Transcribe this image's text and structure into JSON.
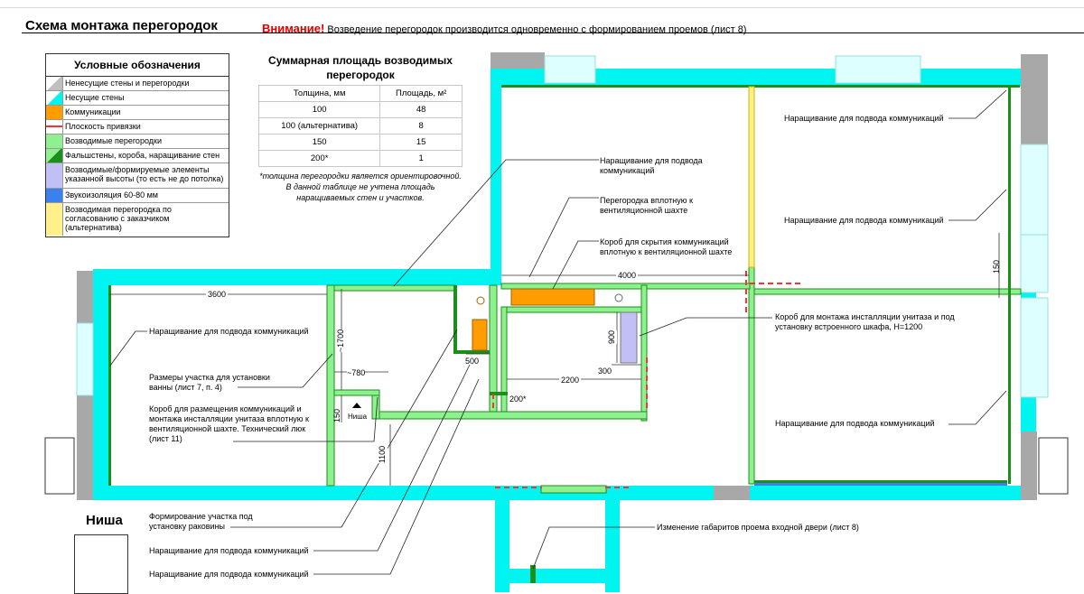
{
  "title": "Схема монтажа перегородок",
  "warning": {
    "bold": "Внимание!",
    "text": "Возведение перегородок производится одновременно с формированием проемов (лист 8)"
  },
  "legend": {
    "title": "Условные обозначения",
    "items": [
      {
        "label": "Ненесущие стены и перегородки",
        "color": "#bfbfbf"
      },
      {
        "label": "Несущие стены",
        "color": "#00f5f0"
      },
      {
        "label": "Коммуникации",
        "color": "#ff9c00"
      },
      {
        "label": "Плоскость привязки",
        "color": "#ff3030"
      },
      {
        "label": "Возводимые перегородки",
        "color": "#8ef08e"
      },
      {
        "label": "Фальшстены, короба, наращивание стен",
        "color": "#1a8f1a"
      },
      {
        "label": "Возводимые/формируемые элементы указанной высоты (то есть не до потолка)",
        "color": "#c0c0f4"
      },
      {
        "label": "Звукоизоляция 60-80 мм",
        "color": "#3a80ee"
      },
      {
        "label": "Возводимая перегородка по согласованию с заказчиком (альтернатива)",
        "color": "#fff08a"
      }
    ]
  },
  "summary": {
    "title": "Суммарная площадь возводимых перегородок",
    "headers": [
      "Толщина, мм",
      "Площадь, м²"
    ],
    "rows": [
      [
        "100",
        "48"
      ],
      [
        "100 (альтернатива)",
        "8"
      ],
      [
        "150",
        "15"
      ],
      [
        "200*",
        "1"
      ]
    ],
    "note": "*толщина перегородки является ориентировочной. В данной таблице не учтена площадь наращиваемых стен и участков."
  },
  "annotations": {
    "a1": "Наращивание для подвода коммуникаций",
    "a2": "Перегородка вплотную к вентиляционной шахте",
    "a3": "Короб для скрытия коммуникаций вплотную к вентиляционной шахте",
    "a4": "Наращивание для подвода коммуникаций",
    "a5": "Наращивание для подвода коммуникаций",
    "a6": "Короб для монтажа инсталляции унитаза и под установку встроенного шкафа, H=1200",
    "a7": "Наращивание для подвода коммуникаций",
    "a8": "Наращивание для подвода коммуникаций",
    "a9": "Размеры участка для установки ванны (лист 7, п. 4)",
    "a10": "Короб для размещения коммуникаций и монтажа инсталляции унитаза вплотную к вентиляционной шахте. Технический люк (лист 11)",
    "a11": "Формирование участка под установку раковины",
    "a12": "Наращивание для подвода коммуникаций",
    "a13": "Наращивание для подвода коммуникаций",
    "a14": "Изменение габаритов проема входной двери (лист 8)"
  },
  "dimensions": {
    "d3600": "3600",
    "d4000": "4000",
    "d150r": "150",
    "d1700": "~1700",
    "d780": "~780",
    "d500": "500",
    "d900": "900",
    "d300": "300",
    "d2200": "2200",
    "d200": "200*",
    "d150": "150",
    "d1100": "1100",
    "niche_small": "Ниша"
  },
  "niche": {
    "title": "Ниша"
  }
}
